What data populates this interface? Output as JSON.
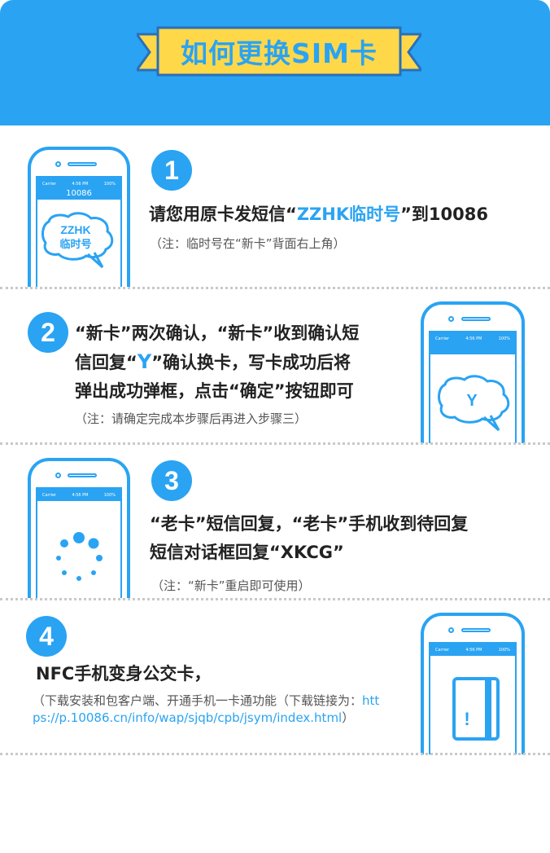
{
  "header": {
    "title": "如何更换SIM卡"
  },
  "colors": {
    "accent": "#2aa3f3",
    "banner": "#ffd84a",
    "text": "#222222",
    "note": "#555555"
  },
  "phone_status": {
    "carrier": "Carrier",
    "time": "4:56 PM",
    "battery": "100%"
  },
  "steps": [
    {
      "number": "1",
      "text_before": "请您用原卡发短信“",
      "highlight": "ZZHK临时号",
      "text_after": "”到10086",
      "note": "（注：临时号在“新卡”背面右上角）",
      "phone_screen_title": "10086",
      "bubble_line1": "ZZHK",
      "bubble_line2": "临时号"
    },
    {
      "number": "2",
      "line1": "“新卡”两次确认，“新卡”收到确认短",
      "line2_before": "信回复“",
      "line2_highlight": "Y",
      "line2_after": "”确认换卡，写卡成功后将",
      "line3": "弹出成功弹框，点击“确定”按钮即可",
      "note": "（注：请确定完成本步骤后再进入步骤三）",
      "bubble_text": "Y"
    },
    {
      "number": "3",
      "line1": "“老卡”短信回复，“老卡”手机收到待回复",
      "line2": "短信对话框回复“XKCG”",
      "note": "（注：“新卡”重启即可使用）"
    },
    {
      "number": "4",
      "line1": "NFC手机变身公交卡，",
      "note_before": "（下载安装和包客户端、开通手机一卡通功能（下载链接为：",
      "note_link": "https://p.10086.cn/info/wap/sjqb/cpb/jsym/index.html",
      "note_after": "）",
      "card_mark": "!"
    }
  ]
}
